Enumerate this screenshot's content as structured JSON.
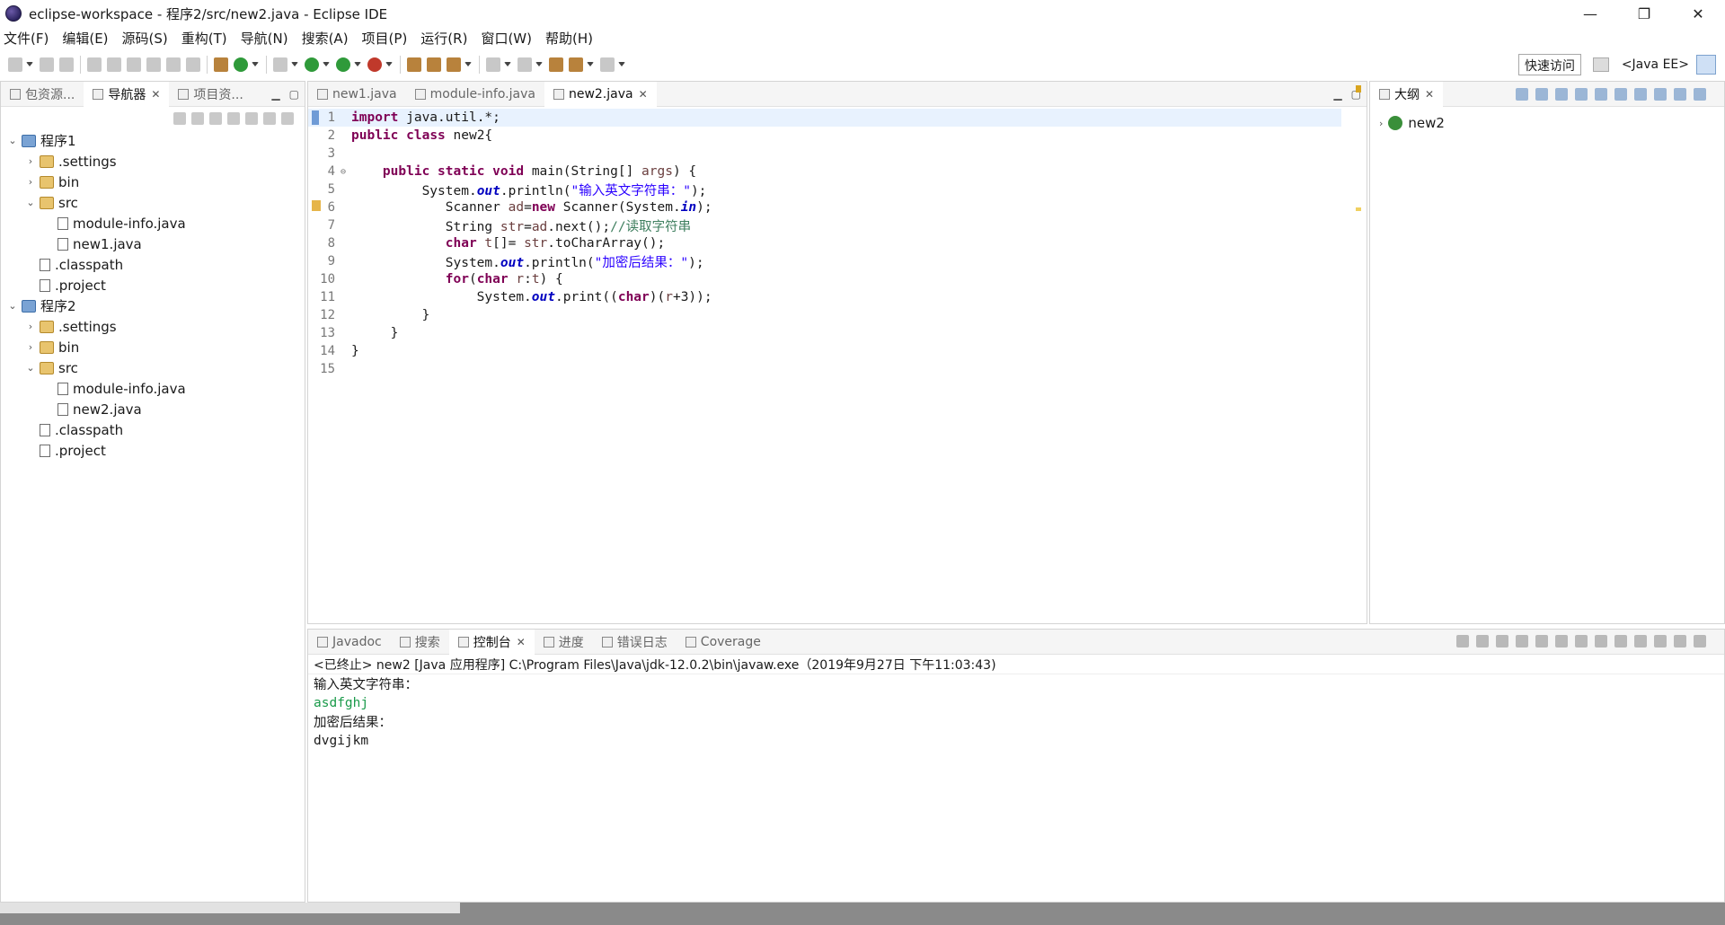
{
  "window": {
    "title": "eclipse-workspace - 程序2/src/new2.java - Eclipse IDE",
    "min": "—",
    "max": "❐",
    "close": "✕"
  },
  "menu": [
    "文件(F)",
    "编辑(E)",
    "源码(S)",
    "重构(T)",
    "导航(N)",
    "搜索(A)",
    "项目(P)",
    "运行(R)",
    "窗口(W)",
    "帮助(H)"
  ],
  "toolbar": {
    "quick_access": "快速访问",
    "perspective": "<Java EE>"
  },
  "left_panel": {
    "tabs": [
      {
        "label": "包资源...",
        "active": false
      },
      {
        "label": "导航器",
        "active": true
      },
      {
        "label": "项目资...",
        "active": false
      }
    ],
    "tree": [
      {
        "label": "程序1",
        "icon": "project",
        "depth": 0,
        "twisty": "v"
      },
      {
        "label": ".settings",
        "icon": "folder",
        "depth": 1,
        "twisty": ">"
      },
      {
        "label": "bin",
        "icon": "folder",
        "depth": 1,
        "twisty": ">"
      },
      {
        "label": "src",
        "icon": "folder",
        "depth": 1,
        "twisty": "v"
      },
      {
        "label": "module-info.java",
        "icon": "jfile",
        "depth": 2,
        "twisty": ""
      },
      {
        "label": "new1.java",
        "icon": "jfile",
        "depth": 2,
        "twisty": ""
      },
      {
        "label": ".classpath",
        "icon": "xfile",
        "depth": 1,
        "twisty": ""
      },
      {
        "label": ".project",
        "icon": "xfile",
        "depth": 1,
        "twisty": ""
      },
      {
        "label": "程序2",
        "icon": "project",
        "depth": 0,
        "twisty": "v"
      },
      {
        "label": ".settings",
        "icon": "folder",
        "depth": 1,
        "twisty": ">"
      },
      {
        "label": "bin",
        "icon": "folder",
        "depth": 1,
        "twisty": ">"
      },
      {
        "label": "src",
        "icon": "folder",
        "depth": 1,
        "twisty": "v"
      },
      {
        "label": "module-info.java",
        "icon": "jfile",
        "depth": 2,
        "twisty": ""
      },
      {
        "label": "new2.java",
        "icon": "jfile",
        "depth": 2,
        "twisty": ""
      },
      {
        "label": ".classpath",
        "icon": "xfile",
        "depth": 1,
        "twisty": ""
      },
      {
        "label": ".project",
        "icon": "xfile",
        "depth": 1,
        "twisty": ""
      }
    ]
  },
  "editor": {
    "tabs": [
      {
        "label": "new1.java",
        "active": false
      },
      {
        "label": "module-info.java",
        "active": false
      },
      {
        "label": "new2.java",
        "active": true
      }
    ],
    "lines": [
      {
        "n": "1",
        "fold": "",
        "html": "<span class='kw'>import</span> java.util.*;"
      },
      {
        "n": "2",
        "fold": "",
        "html": "<span class='kw'>public</span> <span class='kw'>class</span> new2{"
      },
      {
        "n": "3",
        "fold": "",
        "html": ""
      },
      {
        "n": "4",
        "fold": "⊖",
        "html": "    <span class='kw'>public</span> <span class='kw'>static</span> <span class='kw'>void</span> main(String[] <span class='var'>args</span>) {"
      },
      {
        "n": "5",
        "fold": "",
        "html": "         System.<span class='fld'>out</span>.println(<span class='str'>\"输入英文字符串：\"</span>);"
      },
      {
        "n": "6",
        "fold": "",
        "html": "            Scanner <span class='var'>ad</span>=<span class='kw'>new</span> Scanner(System.<span class='fld'>in</span>);"
      },
      {
        "n": "7",
        "fold": "",
        "html": "            String <span class='var'>str</span>=<span class='var'>ad</span>.next();<span class='cmt'>//读取字符串</span>"
      },
      {
        "n": "8",
        "fold": "",
        "html": "            <span class='kw'>char</span> <span class='var'>t</span>[]= <span class='var'>str</span>.toCharArray();"
      },
      {
        "n": "9",
        "fold": "",
        "html": "            System.<span class='fld'>out</span>.println(<span class='str'>\"加密后结果：\"</span>);"
      },
      {
        "n": "10",
        "fold": "",
        "html": "            <span class='kw'>for</span>(<span class='kw'>char</span> <span class='var'>r</span>:<span class='var'>t</span>) {"
      },
      {
        "n": "11",
        "fold": "",
        "html": "                System.<span class='fld'>out</span>.print((<span class='kw'>char</span>)(<span class='var'>r</span>+3));"
      },
      {
        "n": "12",
        "fold": "",
        "html": "         }"
      },
      {
        "n": "13",
        "fold": "",
        "html": "     }"
      },
      {
        "n": "14",
        "fold": "",
        "html": "}"
      },
      {
        "n": "15",
        "fold": "",
        "html": ""
      }
    ]
  },
  "outline": {
    "tab": "大纲",
    "items": [
      {
        "label": "new2"
      }
    ]
  },
  "console": {
    "tabs": [
      {
        "label": "Javadoc",
        "active": false
      },
      {
        "label": "搜索",
        "active": false
      },
      {
        "label": "控制台",
        "active": true
      },
      {
        "label": "进度",
        "active": false
      },
      {
        "label": "错误日志",
        "active": false
      },
      {
        "label": "Coverage",
        "active": false
      }
    ],
    "status": "<已终止> new2 [Java 应用程序] C:\\Program Files\\Java\\jdk-12.0.2\\bin\\javaw.exe（2019年9月27日 下午11:03:43)",
    "output": [
      {
        "text": "输入英文字符串：",
        "kind": "out"
      },
      {
        "text": "asdfghj",
        "kind": "input"
      },
      {
        "text": "加密后结果：",
        "kind": "out"
      },
      {
        "text": "dvgijkm",
        "kind": "out"
      }
    ]
  },
  "colors": {
    "keyword": "#7f0055",
    "string": "#2a00ff",
    "comment": "#3f7f5f",
    "static_field": "#0000c0",
    "console_input": "#1a9a4a"
  }
}
